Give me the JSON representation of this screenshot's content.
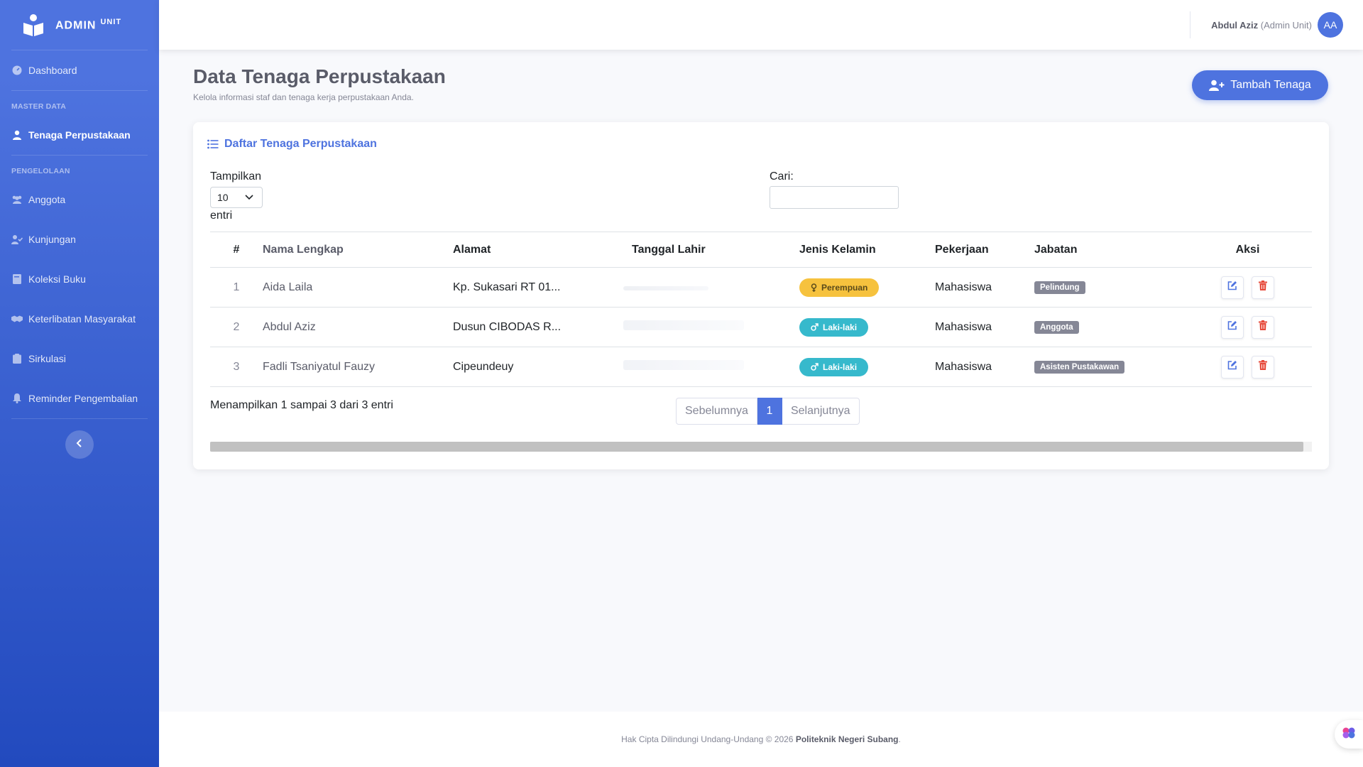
{
  "brand": {
    "name": "ADMIN",
    "suffix": "UNIT"
  },
  "sidebar": {
    "dashboard": "Dashboard",
    "heading_master": "MASTER DATA",
    "tenaga": "Tenaga Perpustakaan",
    "heading_pengelolaan": "PENGELOLAAN",
    "items": [
      {
        "label": "Anggota",
        "icon": "users-icon"
      },
      {
        "label": "Kunjungan",
        "icon": "user-check-icon"
      },
      {
        "label": "Koleksi Buku",
        "icon": "book-icon"
      },
      {
        "label": "Keterlibatan Masyarakat",
        "icon": "handshake-icon"
      },
      {
        "label": "Sirkulasi",
        "icon": "clipboard-icon"
      },
      {
        "label": "Reminder Pengembalian",
        "icon": "bell-icon"
      }
    ]
  },
  "topbar": {
    "user_name": "Abdul Aziz",
    "user_role": "(Admin Unit)",
    "initials": "AA"
  },
  "page": {
    "title": "Data Tenaga Perpustakaan",
    "subtitle": "Kelola informasi staf dan tenaga kerja perpustakaan Anda.",
    "add_button": "Tambah Tenaga"
  },
  "card": {
    "title": "Daftar Tenaga Perpustakaan",
    "show_label": "Tampilkan",
    "show_value": "10",
    "entries_label": "entri",
    "search_label": "Cari:",
    "search_value": ""
  },
  "table": {
    "headers": [
      "#",
      "Nama Lengkap",
      "Alamat",
      "Tanggal Lahir",
      "Jenis Kelamin",
      "Pekerjaan",
      "Jabatan",
      "Aksi"
    ],
    "rows": [
      {
        "num": "1",
        "name": "Aida Laila",
        "address": "Kp. Sukasari RT 01...",
        "gender": "Perempuan",
        "job": "Mahasiswa",
        "position": "Pelindung"
      },
      {
        "num": "2",
        "name": "Abdul Aziz",
        "address": "Dusun CIBODAS R...",
        "gender": "Laki-laki",
        "job": "Mahasiswa",
        "position": "Anggota"
      },
      {
        "num": "3",
        "name": "Fadli Tsaniyatul Fauzy",
        "address": "Cipeundeuy",
        "gender": "Laki-laki",
        "job": "Mahasiswa",
        "position": "Asisten Pustakawan"
      }
    ]
  },
  "pagination": {
    "info": "Menampilkan 1 sampai 3 dari 3 entri",
    "prev": "Sebelumnya",
    "current": "1",
    "next": "Selanjutnya"
  },
  "footer": {
    "text": "Hak Cipta Dilindungi Undang-Undang © 2026",
    "org": "Politeknik Negeri Subang",
    "dot": "."
  },
  "colors": {
    "primary": "#4e73df",
    "warning": "#f6c23e",
    "info": "#36b9cc",
    "danger": "#e74a3b",
    "secondary": "#858796"
  }
}
